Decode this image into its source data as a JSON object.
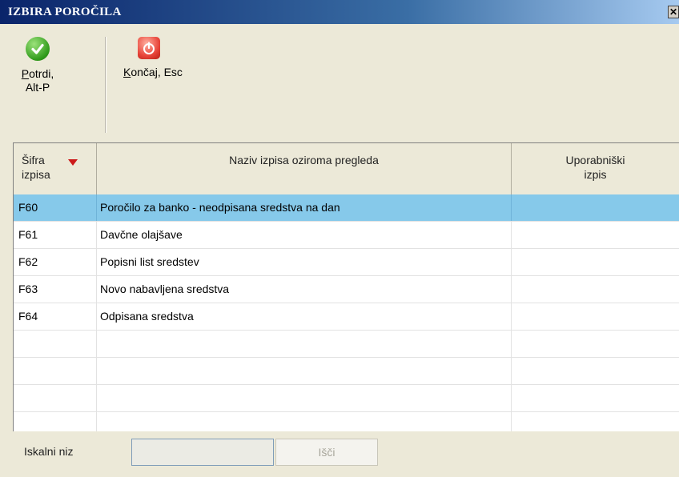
{
  "window": {
    "title": "IZBIRA POROČILA",
    "close_glyph": "✕"
  },
  "toolbar": {
    "confirm": {
      "label_line1": "Potrdi,",
      "label_line2": "Alt-P",
      "icon": "check-icon"
    },
    "end": {
      "label": "Končaj, Esc",
      "icon": "power-icon"
    }
  },
  "table": {
    "columns": [
      {
        "line1": "Šifra",
        "line2": "izpisa"
      },
      {
        "line1": "Naziv izpisa oziroma pregleda",
        "line2": ""
      },
      {
        "line1": "Uporabniški",
        "line2": "izpis"
      }
    ],
    "rows": [
      {
        "code": "F60",
        "name": "Poročilo za banko - neodpisana sredstva na dan",
        "user": ""
      },
      {
        "code": "F61",
        "name": "Davčne olajšave",
        "user": ""
      },
      {
        "code": "F62",
        "name": "Popisni list sredstev",
        "user": ""
      },
      {
        "code": "F63",
        "name": "Novo nabavljena sredstva",
        "user": ""
      },
      {
        "code": "F64",
        "name": "Odpisana sredstva",
        "user": ""
      },
      {
        "code": "",
        "name": "",
        "user": ""
      },
      {
        "code": "",
        "name": "",
        "user": ""
      },
      {
        "code": "",
        "name": "",
        "user": ""
      },
      {
        "code": "",
        "name": "",
        "user": ""
      }
    ],
    "selected_row": 0,
    "colors": {
      "selected": "#86c9ea",
      "sort_arrow": "#cc1a1a"
    }
  },
  "search": {
    "label": "Iskalni niz",
    "value": "",
    "button_label": "Išči"
  }
}
